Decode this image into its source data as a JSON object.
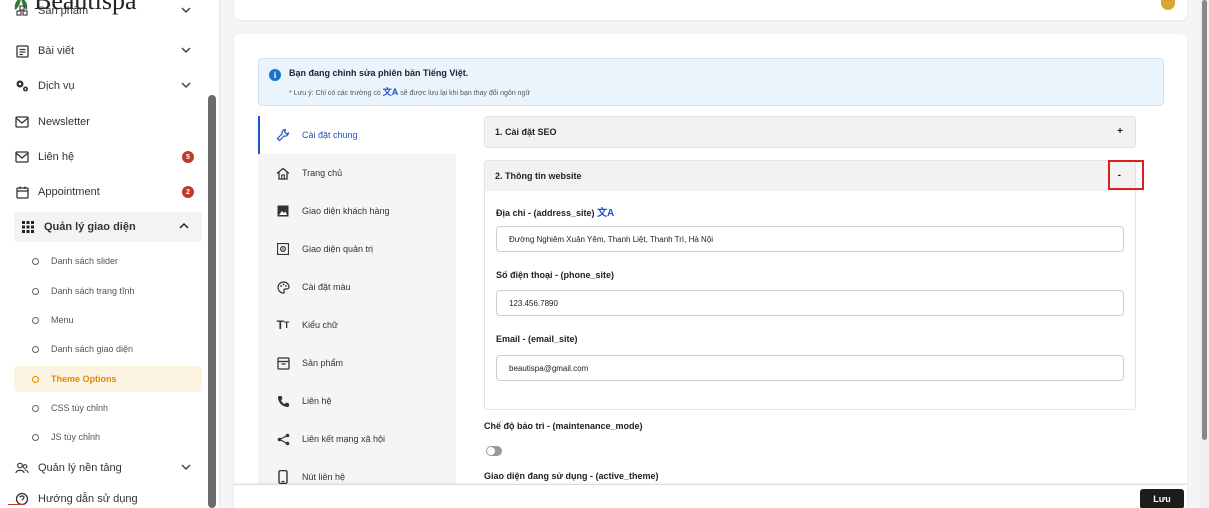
{
  "brand": {
    "name": "Beautispa"
  },
  "sidebar": {
    "items": [
      {
        "label": "Sản phẩm",
        "icon": "product-icon"
      },
      {
        "label": "Bài viết",
        "icon": "article-icon"
      },
      {
        "label": "Dịch vụ",
        "icon": "gears-icon"
      },
      {
        "label": "Newsletter",
        "icon": "mail-icon"
      },
      {
        "label": "Liên hệ",
        "icon": "mail-icon",
        "badge": "5"
      },
      {
        "label": "Appointment",
        "icon": "calendar-icon",
        "badge": "2"
      },
      {
        "label": "Quản lý giao diện",
        "icon": "grid-icon"
      },
      {
        "label": "Quản lý nền tảng",
        "icon": "users-icon"
      },
      {
        "label": "Hướng dẫn sử dụng",
        "icon": "help-icon"
      }
    ],
    "sub_items": [
      "Danh sách slider",
      "Danh sách trang tĩnh",
      "Menu",
      "Danh sách giao diện",
      "Theme Options",
      "CSS tùy chỉnh",
      "JS tùy chỉnh"
    ]
  },
  "info": {
    "title": "Bạn đang chỉnh sửa phiên bản Tiếng Việt.",
    "note_before": "* Lưu ý: Chỉ có các trường có",
    "note_after": "sẽ được lưu lại khi bạn thay đổi ngôn ngữ"
  },
  "settings_menu": [
    "Cài đặt chung",
    "Trang chủ",
    "Giao diện khách hàng",
    "Giao diện quản trị",
    "Cài đặt màu",
    "Kiểu chữ",
    "Sản phẩm",
    "Liên hệ",
    "Liên kết mạng xã hội",
    "Nút liên hệ"
  ],
  "sections": {
    "seo": {
      "title": "1. Cài đặt SEO",
      "toggle": "+"
    },
    "website": {
      "title": "2. Thông tin website",
      "toggle": "-"
    }
  },
  "fields": {
    "address": {
      "label": "Địa chỉ - (address_site)",
      "value": "Đường Nghiêm Xuân Yêm, Thanh Liệt, Thanh Trì, Hà Nội"
    },
    "phone": {
      "label": "Số điện thoại - (phone_site)",
      "value": "123.456.7890"
    },
    "email": {
      "label": "Email - (email_site)",
      "value": "beautispa@gmail.com"
    }
  },
  "maintenance": {
    "label": "Chế độ bảo trì - (maintenance_mode)"
  },
  "active_theme": {
    "label": "Giao diện đang sử dụng - (active_theme)"
  },
  "save_label": "Lưu",
  "colors": {
    "accent": "#1a56c9",
    "active_sub": "#e08a00",
    "badge": "#c0392b",
    "highlight": "#e01e1e"
  }
}
